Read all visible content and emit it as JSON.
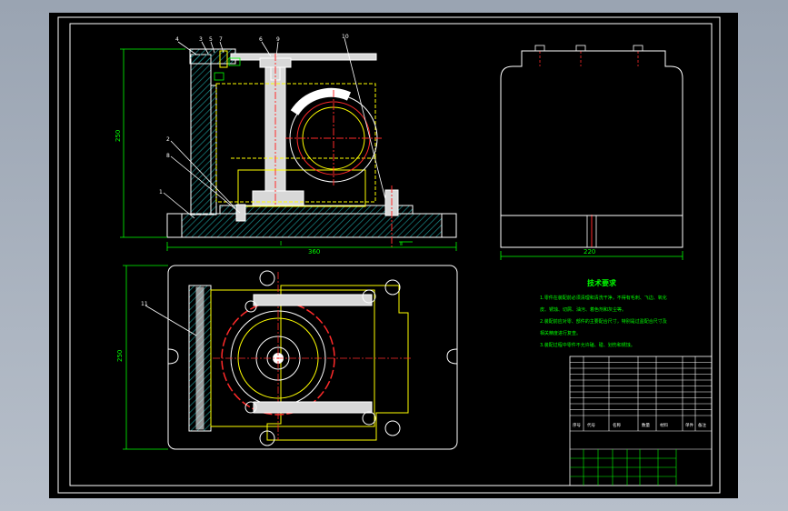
{
  "colors": {
    "background": "#000000",
    "frame": "#ffffff",
    "outline": "#ffffff",
    "hidden": "#ffff00",
    "center": "#ff2a2a",
    "dimension": "#00ff00",
    "hatch": "#1a8c8c",
    "part_fill": "#d8d8d8"
  },
  "front_view": {
    "balloons": [
      "4",
      "3",
      "5",
      "7",
      "6",
      "9",
      "10",
      "2",
      "8",
      "1"
    ],
    "dim_width": "360",
    "dim_height": "250",
    "dim_note": "Ⅰ",
    "dim_small": "Ⅱ"
  },
  "side_view": {
    "dim_width": "220"
  },
  "top_view": {
    "balloon": "11",
    "dim_height": "250"
  },
  "notes": {
    "title": "技术要求",
    "lines": [
      "1.零件在装配前必须清理和清洗干净，不得有毛刺、飞边、氧化",
      "皮、锈蚀、切屑、油污、着色剂和灰尘等。",
      "2.装配前应对零、部件的主要配合尺寸，特别是过盈配合尺寸及",
      "相关精度进行复查。",
      "3.装配过程中零件不允许磕、碰、划伤和锈蚀。"
    ]
  },
  "title_block": {
    "head_seq": "序号",
    "head_code": "代号",
    "head_name": "名称",
    "head_qty": "数量",
    "head_mat": "材料",
    "head_mass": "单件",
    "head_remark": "备注"
  }
}
